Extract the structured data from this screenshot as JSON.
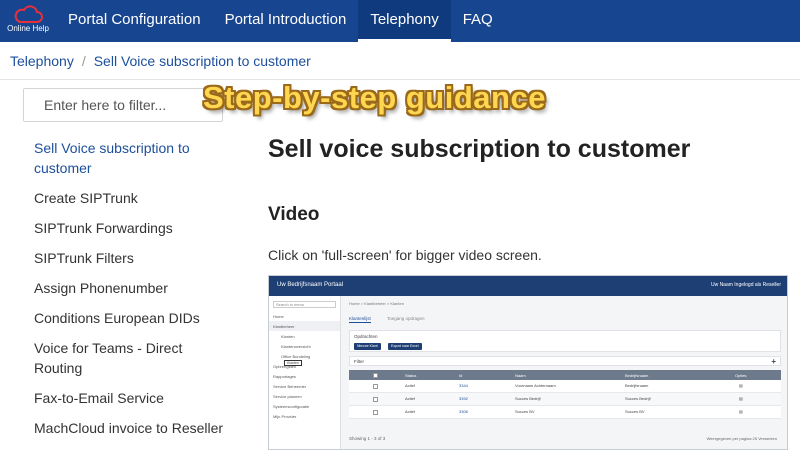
{
  "logo": {
    "text": "Online Help"
  },
  "nav": {
    "items": [
      {
        "label": "Portal Configuration"
      },
      {
        "label": "Portal Introduction"
      },
      {
        "label": "Telephony"
      },
      {
        "label": "FAQ"
      }
    ],
    "active": "Telephony"
  },
  "breadcrumb": {
    "parent": "Telephony",
    "separator": "/",
    "current": "Sell Voice subscription to customer"
  },
  "sidebar": {
    "filter_placeholder": "Enter here to filter...",
    "items": [
      {
        "label": "Sell Voice subscription to customer"
      },
      {
        "label": "Create SIPTrunk"
      },
      {
        "label": "SIPTrunk Forwardings"
      },
      {
        "label": "SIPTrunk Filters"
      },
      {
        "label": "Assign Phonenumber"
      },
      {
        "label": "Conditions European DIDs"
      },
      {
        "label": "Voice for Teams - Direct Routing"
      },
      {
        "label": "Fax-to-Email Service"
      },
      {
        "label": "MachCloud invoice to Reseller"
      }
    ]
  },
  "overlay": {
    "text": "Step-by-step guidance"
  },
  "main": {
    "title": "Sell voice subscription to customer",
    "section": "Video",
    "description": "Click on 'full-screen' for bigger video screen."
  },
  "video": {
    "app_title": "Uw Bedrijfsnaam Portaal",
    "top_right": "Uw Naam   Ingelogd als Reseller",
    "search": "Search in menu",
    "menu": [
      "Home",
      "Klantbeheer",
      "Klanten",
      "Klantenoverzicht",
      "Office Bundeling",
      "Opbrengsten",
      "Rapportages",
      "Service Beheerder",
      "Service plannen",
      "Systeemconfiguratie",
      "Mijn Provider"
    ],
    "tooltip": "Klanten",
    "crumb": "Home > Klantbeheer > Klanten",
    "tabs": [
      "Klantenlijst",
      "Toegang opdragen"
    ],
    "card_title": "Opdrachten",
    "buttons": [
      "Nieuwe Klant",
      "Export naar Excel"
    ],
    "filter": "Filter",
    "filter_plus": "+",
    "columns": [
      "Status",
      "Id",
      "Naam",
      "Bedrijfsnaam",
      "Opties"
    ],
    "rows": [
      {
        "status": "Actief",
        "id": "3344",
        "name": "Voornaam Achternaam",
        "company": "Bedrijfsnaam"
      },
      {
        "status": "Actief",
        "id": "3392",
        "name": "Succes Bedrijf",
        "company": "Succes Bedrijf"
      },
      {
        "status": "Actief",
        "id": "3306",
        "name": "Succes BV",
        "company": "Succes BV"
      }
    ],
    "footer_left": "Showing 1 - 3 of 3",
    "footer_right": "Weergegeven per pagina   25   Verwerken"
  },
  "colors": {
    "nav_bg": "#17458f",
    "link": "#1c4f9c",
    "overlay_text": "#ffd650"
  }
}
